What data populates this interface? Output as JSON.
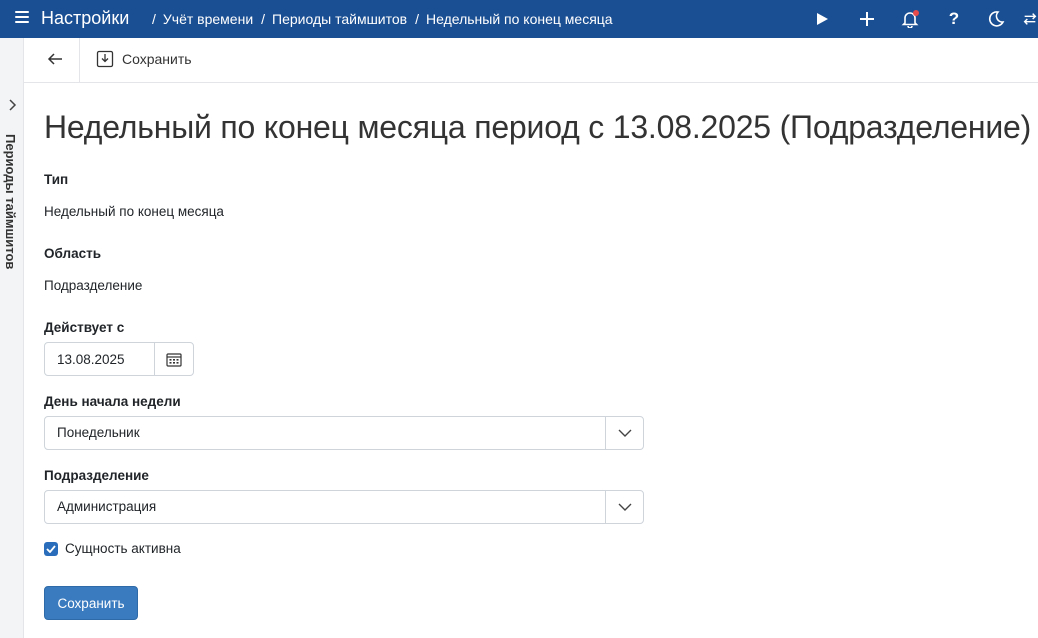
{
  "header": {
    "app_title": "Настройки",
    "breadcrumbs": [
      "Учёт времени",
      "Периоды таймшитов",
      "Недельный по конец месяца"
    ],
    "separator": "/",
    "help_label": "?",
    "icons": [
      "menu-icon",
      "play-icon",
      "plus-icon",
      "bell-icon",
      "help-icon",
      "moon-icon",
      "swap-icon"
    ],
    "background_color": "#1b4f93",
    "notification_dot_color": "#e54b4b"
  },
  "sidebar": {
    "label": "Периоды таймшитов"
  },
  "toolbar": {
    "save_label": "Сохранить"
  },
  "page": {
    "title": "Недельный по конец месяца период с 13.08.2025 (Подразделение)"
  },
  "form": {
    "type_label": "Тип",
    "type_value": "Недельный по конец месяца",
    "scope_label": "Область",
    "scope_value": "Подразделение",
    "valid_from_label": "Действует с",
    "valid_from_value": "13.08.2025",
    "week_start_label": "День начала недели",
    "week_start_value": "Понедельник",
    "department_label": "Подразделение",
    "department_value": "Администрация",
    "active_label": "Сущность активна",
    "active_checked": true,
    "submit_label": "Сохранить",
    "accent_color": "#3a7bbf"
  }
}
